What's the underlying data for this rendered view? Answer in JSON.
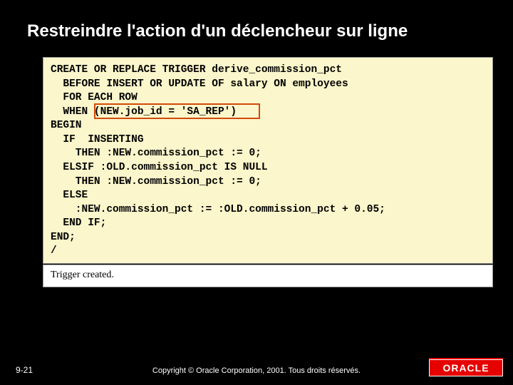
{
  "title": "Restreindre l'action d'un déclencheur sur ligne",
  "code": {
    "l1": "CREATE OR REPLACE TRIGGER derive_commission_pct",
    "l2": "  BEFORE INSERT OR UPDATE OF salary ON employees",
    "l3": "  FOR EACH ROW",
    "l4": "  WHEN (NEW.job_id = 'SA_REP')",
    "l5": "BEGIN",
    "l6": "  IF  INSERTING",
    "l7": "    THEN :NEW.commission_pct := 0;",
    "l8": "  ELSIF :OLD.commission_pct IS NULL",
    "l9": "    THEN :NEW.commission_pct := 0;",
    "l10": "  ELSE",
    "l11": "    :NEW.commission_pct := :OLD.commission_pct + 0.05;",
    "l12": "  END IF;",
    "l13": "END;",
    "l14": "/"
  },
  "result": "Trigger created.",
  "footer": {
    "slide_num": "9-21",
    "copyright": "Copyright © Oracle Corporation, 2001. Tous droits réservés.",
    "logo": "ORACLE"
  }
}
